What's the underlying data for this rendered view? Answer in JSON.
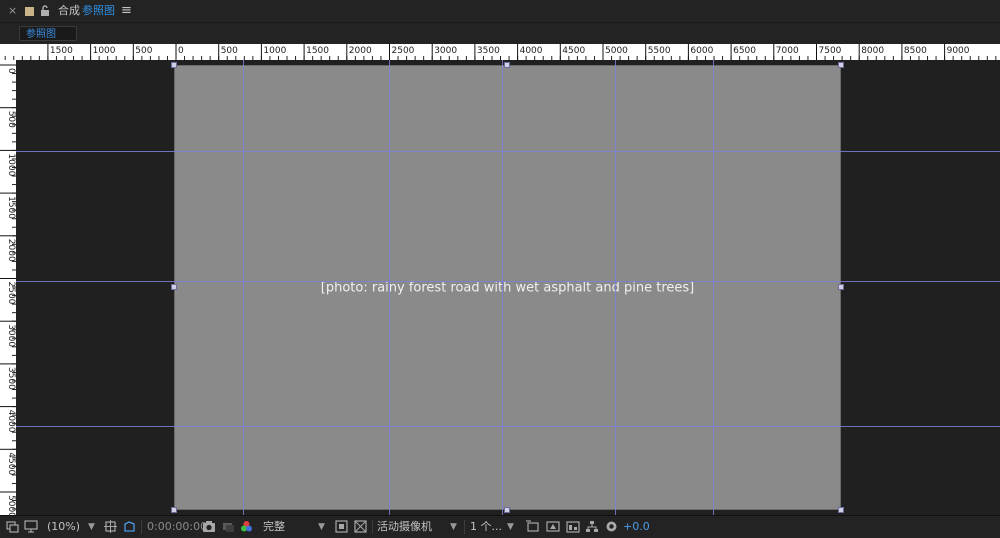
{
  "header": {
    "close_glyph": "×",
    "comp_label": "合成",
    "comp_name": "参照图",
    "menu_glyph": "≡",
    "swatch_color": "#c8b488"
  },
  "tab": {
    "label": "参照图"
  },
  "ruler": {
    "top_labels": [
      "1500",
      "1000",
      "500",
      "0",
      "500",
      "1000",
      "1500",
      "2000",
      "2500",
      "3000",
      "3500",
      "4000",
      "4500",
      "5000",
      "5500",
      "6000",
      "6500",
      "7000",
      "7500",
      "8000",
      "8500",
      "9000"
    ],
    "left_labels": [
      "0",
      "500",
      "1000",
      "1500",
      "2000",
      "2500",
      "3000",
      "3500",
      "4000",
      "4500",
      "5000"
    ]
  },
  "viewport": {
    "photo_label": "[photo: rainy forest road with wet asphalt and pine trees]",
    "guide_color": "#7b7fd6"
  },
  "toolbar": {
    "zoom": "(10%)",
    "timecode": "0:00:00:00",
    "resolution": "完整",
    "camera": "活动摄像机",
    "views": "1 个...",
    "exposure": "+0.0"
  }
}
